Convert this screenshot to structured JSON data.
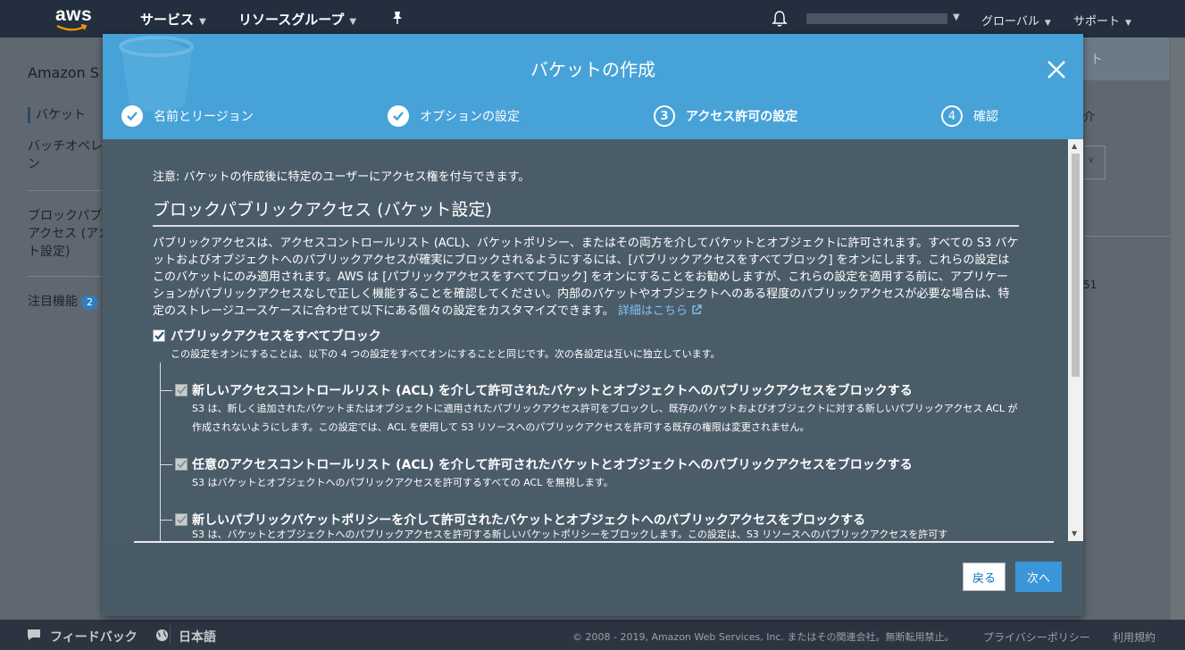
{
  "topnav": {
    "logo": "aws",
    "services": "サービス",
    "resource_groups": "リソースグループ",
    "region": "グローバル",
    "support": "サポート"
  },
  "sidebar": {
    "title": "Amazon S",
    "items": [
      {
        "label": "バケット"
      },
      {
        "label": "バッチオペレーション",
        "line1": "バッチオペレ",
        "line2": "ン"
      },
      {
        "label": "ブロックパブリックアクセス (アカウント設定)",
        "line1": "ブロックパブ",
        "line2": "アクセス (アカ",
        "line3": "ト設定)"
      },
      {
        "label": "注目機能",
        "badge": "2"
      }
    ]
  },
  "rightpanel": {
    "band_text": "ト",
    "text1": "介",
    "text2": "51"
  },
  "modal": {
    "title": "バケットの作成",
    "steps": [
      {
        "label": "名前とリージョン",
        "status": "done"
      },
      {
        "label": "オプションの設定",
        "status": "done"
      },
      {
        "label": "アクセス許可の設定",
        "number": "3",
        "status": "current"
      },
      {
        "label": "確認",
        "number": "4",
        "status": "pending"
      }
    ],
    "note": "注意: バケットの作成後に特定のユーザーにアクセス権を付与できます。",
    "heading": "ブロックパブリックアクセス (バケット設定)",
    "paragraph": "パブリックアクセスは、アクセスコントロールリスト (ACL)、バケットポリシー、またはその両方を介してバケットとオブジェクトに許可されます。すべての S3 バケットおよびオブジェクトへのパブリックアクセスが確実にブロックされるようにするには、[パブリックアクセスをすべてブロック] をオンにします。これらの設定はこのバケットにのみ適用されます。AWS は [パブリックアクセスをすべてブロック] をオンにすることをお勧めしますが、これらの設定を適用する前に、アプリケーションがパブリックアクセスなしで正しく機能することを確認してください。内部のバケットやオブジェクトへのある程度のパブリックアクセスが必要な場合は、特定のストレージユースケースに合わせて以下にある個々の設定をカスタマイズできます。",
    "paragraph_link": "詳細はこちら",
    "block_all": {
      "label": "パブリックアクセスをすべてブロック",
      "checked": true,
      "description": "この設定をオンにすることは、以下の 4 つの設定をすべてオンにすることと同じです。次の各設定は互いに独立しています。"
    },
    "sub_settings": [
      {
        "label": "新しいアクセスコントロールリスト (ACL) を介して許可されたバケットとオブジェクトへのパブリックアクセスをブロックする",
        "description": "S3 は、新しく追加されたバケットまたはオブジェクトに適用されたパブリックアクセス許可をブロックし、既存のバケットおよびオブジェクトに対する新しいパブリックアクセス ACL が作成されないようにします。この設定では、ACL を使用して S3 リソースへのパブリックアクセスを許可する既存の権限は変更されません。",
        "checked": true
      },
      {
        "label": "任意のアクセスコントロールリスト (ACL) を介して許可されたバケットとオブジェクトへのパブリックアクセスをブロックする",
        "description": "S3 はバケットとオブジェクトへのパブリックアクセスを許可するすべての ACL を無視します。",
        "checked": true
      },
      {
        "label": "新しいパブリックバケットポリシーを介して許可されたバケットとオブジェクトへのパブリックアクセスをブロックする",
        "description": "S3 は、バケットとオブジェクトへのパブリックアクセスを許可する新しいバケットポリシーをブロックします。この設定は、S3 リソースへのパブリックアクセスを許可す",
        "checked": true
      }
    ],
    "back_button": "戻る",
    "next_button": "次へ"
  },
  "footer": {
    "feedback": "フィードバック",
    "language": "日本語",
    "copyright": "© 2008 - 2019, Amazon Web Services, Inc. またはその関連会社。無断転用禁止。",
    "privacy": "プライバシーポリシー",
    "terms": "利用規約"
  }
}
